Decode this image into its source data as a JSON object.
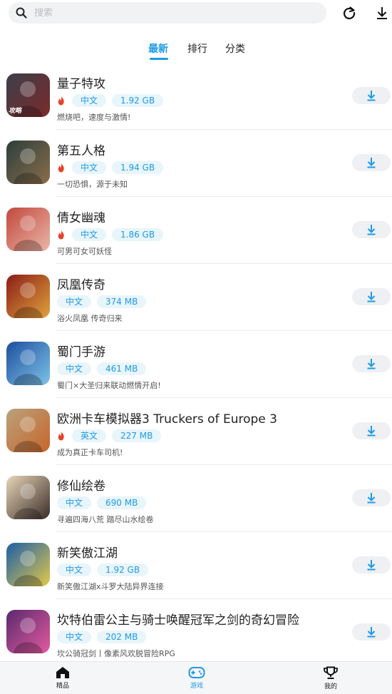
{
  "search": {
    "placeholder": "搜索",
    "value": ""
  },
  "topbar": {
    "refresh_icon": "refresh-icon",
    "download_icon": "download-icon"
  },
  "tabs": [
    {
      "label": "最新",
      "active": true
    },
    {
      "label": "排行",
      "active": false
    },
    {
      "label": "分类",
      "active": false
    }
  ],
  "games": [
    {
      "name": "量子特攻",
      "hot": true,
      "lang": "中文",
      "size": "1.92 GB",
      "desc": "燃烧吧，速度与激情!",
      "thumb_colors": [
        "#3b3f4a",
        "#7b2a2a"
      ],
      "thumb_text": "攻略"
    },
    {
      "name": "第五人格",
      "hot": true,
      "lang": "中文",
      "size": "1.94 GB",
      "desc": "一切恐惧，源于未知",
      "thumb_colors": [
        "#2c3e3c",
        "#8a6e4b"
      ],
      "thumb_text": ""
    },
    {
      "name": "倩女幽魂",
      "hot": true,
      "lang": "中文",
      "size": "1.86 GB",
      "desc": "可男可女可妖怪",
      "thumb_colors": [
        "#c2483c",
        "#e9b6a8"
      ],
      "thumb_text": ""
    },
    {
      "name": "凤凰传奇",
      "hot": false,
      "lang": "中文",
      "size": "374 MB",
      "desc": "浴火凤凰 传奇归来",
      "thumb_colors": [
        "#8a1d17",
        "#e0a23b"
      ],
      "thumb_text": ""
    },
    {
      "name": "蜀门手游",
      "hot": false,
      "lang": "中文",
      "size": "461 MB",
      "desc": "蜀门×大圣归来联动燃情开启!",
      "thumb_colors": [
        "#1d4f9e",
        "#7dc3e8"
      ],
      "thumb_text": ""
    },
    {
      "name": "欧洲卡车模拟器3 Truckers of Europe 3",
      "hot": true,
      "lang": "英文",
      "size": "227 MB",
      "desc": "成为真正卡车司机!",
      "thumb_colors": [
        "#b9a27c",
        "#c7652a"
      ],
      "thumb_text": ""
    },
    {
      "name": "修仙绘卷",
      "hot": false,
      "lang": "中文",
      "size": "690 MB",
      "desc": "寻遍四海八荒 踏尽山水绘卷",
      "thumb_colors": [
        "#e7d6b8",
        "#3a2c28"
      ],
      "thumb_text": ""
    },
    {
      "name": "新笑傲江湖",
      "hot": false,
      "lang": "中文",
      "size": "1.92 GB",
      "desc": "新笑傲江湖x斗罗大陆异界连接",
      "thumb_colors": [
        "#1c5fa8",
        "#e3c84a"
      ],
      "thumb_text": ""
    },
    {
      "name": "坎特伯雷公主与骑士唤醒冠军之剑的奇幻冒险",
      "hot": false,
      "lang": "中文",
      "size": "202 MB",
      "desc": "坎公骑冠剑丨像素风欢脱冒险RPG",
      "thumb_colors": [
        "#5a2a6e",
        "#e35aa0"
      ],
      "thumb_text": ""
    }
  ],
  "bottom_nav": [
    {
      "label": "精品",
      "icon": "home-icon",
      "active": false
    },
    {
      "label": "游戏",
      "icon": "gamepad-icon",
      "active": true
    },
    {
      "label": "我的",
      "icon": "trophy-icon",
      "active": false
    }
  ],
  "colors": {
    "accent": "#1e9be6",
    "hot": "#e8412c"
  }
}
